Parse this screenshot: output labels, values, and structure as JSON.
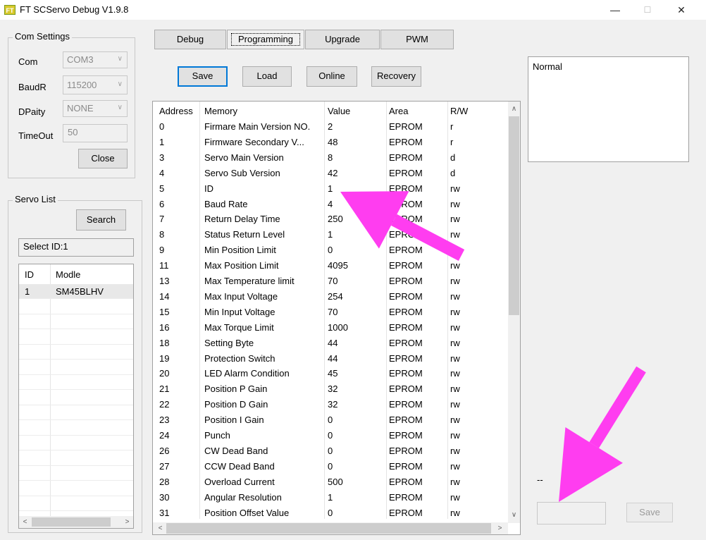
{
  "window": {
    "title": "FT SCServo Debug V1.9.8",
    "icon_text": "FT",
    "controls": {
      "minimize": "—",
      "maximize": "☐",
      "close": "✕"
    }
  },
  "com_settings": {
    "title": "Com Settings",
    "com": {
      "label": "Com",
      "value": "COM3"
    },
    "baud": {
      "label": "BaudR",
      "value": "115200"
    },
    "parity": {
      "label": "DPaity",
      "value": "NONE"
    },
    "timeout": {
      "label": "TimeOut",
      "value": "50"
    },
    "close_button": "Close"
  },
  "servo_list": {
    "title": "Servo List",
    "search_button": "Search",
    "select_id": "Select ID:1",
    "headers": [
      "ID",
      "Modle"
    ],
    "rows": [
      {
        "id": "1",
        "model": "SM45BLHV"
      }
    ]
  },
  "tabs": [
    "Debug",
    "Programming",
    "Upgrade",
    "PWM"
  ],
  "active_tab": "Programming",
  "toolbar": {
    "save": "Save",
    "load": "Load",
    "online": "Online",
    "recovery": "Recovery"
  },
  "memory_table": {
    "headers": [
      "Address",
      "Memory",
      "Value",
      "Area",
      "R/W"
    ],
    "rows": [
      [
        "0",
        "Firmare Main Version NO.",
        "2",
        "EPROM",
        "r"
      ],
      [
        "1",
        "Firmware Secondary V...",
        "48",
        "EPROM",
        "r"
      ],
      [
        "3",
        "Servo Main Version",
        "8",
        "EPROM",
        "d"
      ],
      [
        "4",
        "Servo Sub Version",
        "42",
        "EPROM",
        "d"
      ],
      [
        "5",
        "ID",
        "1",
        "EPROM",
        "rw"
      ],
      [
        "6",
        "Baud Rate",
        "4",
        "EPROM",
        "rw"
      ],
      [
        "7",
        "Return Delay Time",
        "250",
        "EPROM",
        "rw"
      ],
      [
        "8",
        "Status Return Level",
        "1",
        "EPROM",
        "rw"
      ],
      [
        "9",
        "Min Position Limit",
        "0",
        "EPROM",
        "rw"
      ],
      [
        "11",
        "Max Position Limit",
        "4095",
        "EPROM",
        "rw"
      ],
      [
        "13",
        "Max Temperature limit",
        "70",
        "EPROM",
        "rw"
      ],
      [
        "14",
        "Max Input Voltage",
        "254",
        "EPROM",
        "rw"
      ],
      [
        "15",
        "Min Input Voltage",
        "70",
        "EPROM",
        "rw"
      ],
      [
        "16",
        "Max Torque Limit",
        "1000",
        "EPROM",
        "rw"
      ],
      [
        "18",
        "Setting Byte",
        "44",
        "EPROM",
        "rw"
      ],
      [
        "19",
        "Protection Switch",
        "44",
        "EPROM",
        "rw"
      ],
      [
        "20",
        "LED Alarm Condition",
        "45",
        "EPROM",
        "rw"
      ],
      [
        "21",
        "Position P Gain",
        "32",
        "EPROM",
        "rw"
      ],
      [
        "22",
        "Position D Gain",
        "32",
        "EPROM",
        "rw"
      ],
      [
        "23",
        "Position I Gain",
        "0",
        "EPROM",
        "rw"
      ],
      [
        "24",
        "Punch",
        "0",
        "EPROM",
        "rw"
      ],
      [
        "26",
        "CW Dead Band",
        "0",
        "EPROM",
        "rw"
      ],
      [
        "27",
        "CCW Dead Band",
        "0",
        "EPROM",
        "rw"
      ],
      [
        "28",
        "Overload Current",
        "500",
        "EPROM",
        "rw"
      ],
      [
        "30",
        "Angular Resolution",
        "1",
        "EPROM",
        "rw"
      ],
      [
        "31",
        "Position Offset Value",
        "0",
        "EPROM",
        "rw"
      ]
    ]
  },
  "status_panel": {
    "text": "Normal"
  },
  "bottom_right": {
    "dash": "--",
    "input_value": "",
    "save_button": "Save"
  },
  "annotations": {
    "arrow_color": "#ff3df0"
  }
}
